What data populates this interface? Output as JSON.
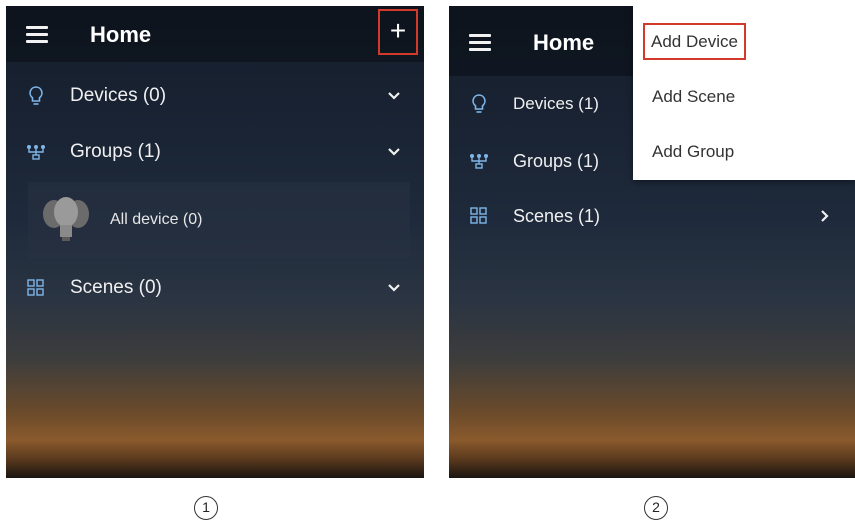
{
  "screens": [
    {
      "app_title": "Home",
      "add_button_label": "+",
      "rows": [
        {
          "icon": "bulb-icon",
          "label": "Devices (0)",
          "chevron": "chevron-down-icon"
        },
        {
          "icon": "group-icon",
          "label": "Groups (1)",
          "chevron": "chevron-down-icon"
        },
        {
          "icon": "scenes-icon",
          "label": "Scenes (0)",
          "chevron": "chevron-down-icon"
        }
      ],
      "group_card": {
        "icon": "bulbs-group-icon",
        "label": "All device (0)"
      }
    },
    {
      "app_title": "Home",
      "rows": [
        {
          "icon": "bulb-icon",
          "label": "Devices (1)"
        },
        {
          "icon": "group-icon",
          "label": "Groups (1)"
        },
        {
          "icon": "scenes-icon",
          "label": "Scenes (1)",
          "chevron": "chevron-right-icon"
        }
      ],
      "menu": {
        "items": [
          "Add Device",
          "Add Scene",
          "Add Group"
        ],
        "highlighted": "Add Device"
      }
    }
  ],
  "step_labels": [
    "1",
    "2"
  ],
  "colors": {
    "highlight": "#d23a2a",
    "icon_blue": "#7fb6e8"
  }
}
